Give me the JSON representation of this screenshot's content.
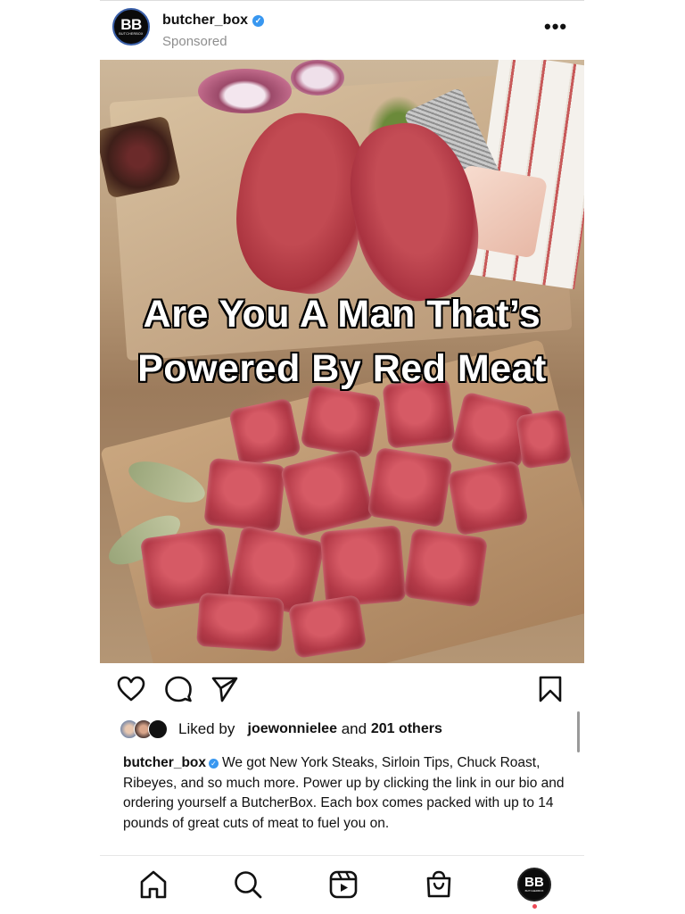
{
  "post": {
    "username": "butcher_box",
    "sponsored_label": "Sponsored",
    "more_label": "•••",
    "avatar_text": "BB",
    "avatar_subtext": "BUTCHERBOX",
    "verified_glyph": "✓",
    "headline": "Are You A Man That’s Powered By Red Meat"
  },
  "actions": {
    "like_icon": "heart-icon",
    "comment_icon": "comment-icon",
    "share_icon": "send-icon",
    "save_icon": "bookmark-icon"
  },
  "likes": {
    "prefix": "Liked by",
    "user": "joewonnielee",
    "middle": "and",
    "others": "201 others"
  },
  "caption": {
    "user": "butcher_box",
    "text": "We got New York Steaks, Sirloin Tips, Chuck Roast, Ribeyes, and so much more. Power up by clicking the link in our bio and ordering yourself a ButcherBox. Each box comes packed with up to 14 pounds of great cuts of meat to fuel you on."
  },
  "nav": {
    "items": [
      "home-icon",
      "search-icon",
      "reels-icon",
      "shop-icon",
      "profile-avatar"
    ],
    "profile_text": "BB",
    "profile_subtext": "BUTCHERBOX",
    "notification_color": "#ed4956"
  },
  "colors": {
    "verified": "#3897f0",
    "secondary_text": "#8e8e8e"
  }
}
